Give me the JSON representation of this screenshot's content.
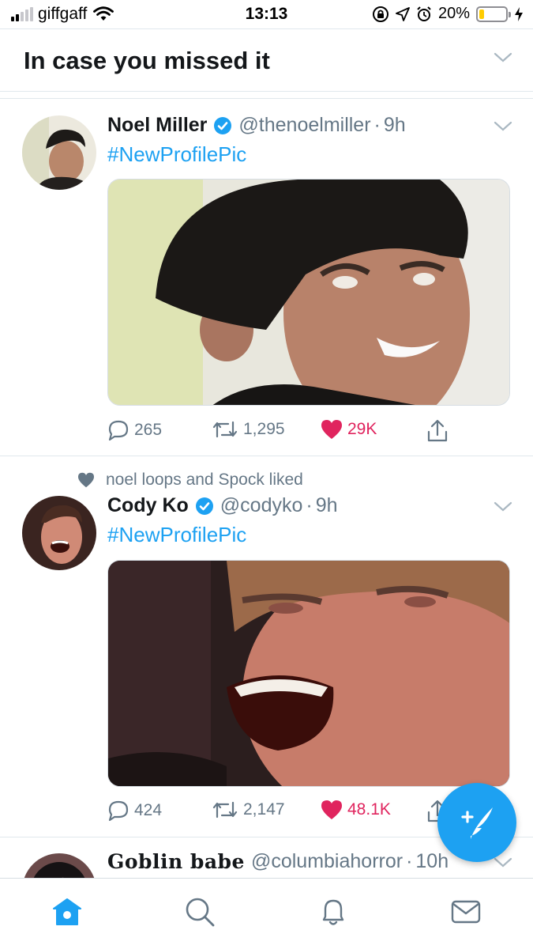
{
  "status_bar": {
    "carrier": "giffgaff",
    "time": "13:13",
    "battery": "20%",
    "battery_level": 0.2,
    "signal_bars": 2
  },
  "section": {
    "title": "In case you missed it"
  },
  "tweets": [
    {
      "name": "Noel Miller",
      "handle": "@thenoelmiller",
      "time": "9h",
      "verified": true,
      "text": "#NewProfilePic",
      "replies": "265",
      "retweets": "1,295",
      "likes": "29K"
    },
    {
      "social_context": "noel loops and Spock liked",
      "name": "Cody Ko",
      "handle": "@codyko",
      "time": "9h",
      "verified": true,
      "text": "#NewProfilePic",
      "replies": "424",
      "retweets": "2,147",
      "likes": "48.1K"
    },
    {
      "name": "Goblin babe",
      "handle": "@columbiahorror",
      "time": "10h"
    }
  ],
  "colors": {
    "accent": "#1da1f2",
    "like": "#e0245e",
    "secondary_text": "#657786",
    "divider": "#e1e8ed"
  },
  "icons": {
    "reply": "reply-icon",
    "retweet": "retweet-icon",
    "like": "heart-icon",
    "share": "share-icon",
    "compose": "compose-tweet-icon",
    "tabs": [
      "home-icon",
      "search-icon",
      "notifications-icon",
      "messages-icon"
    ]
  }
}
